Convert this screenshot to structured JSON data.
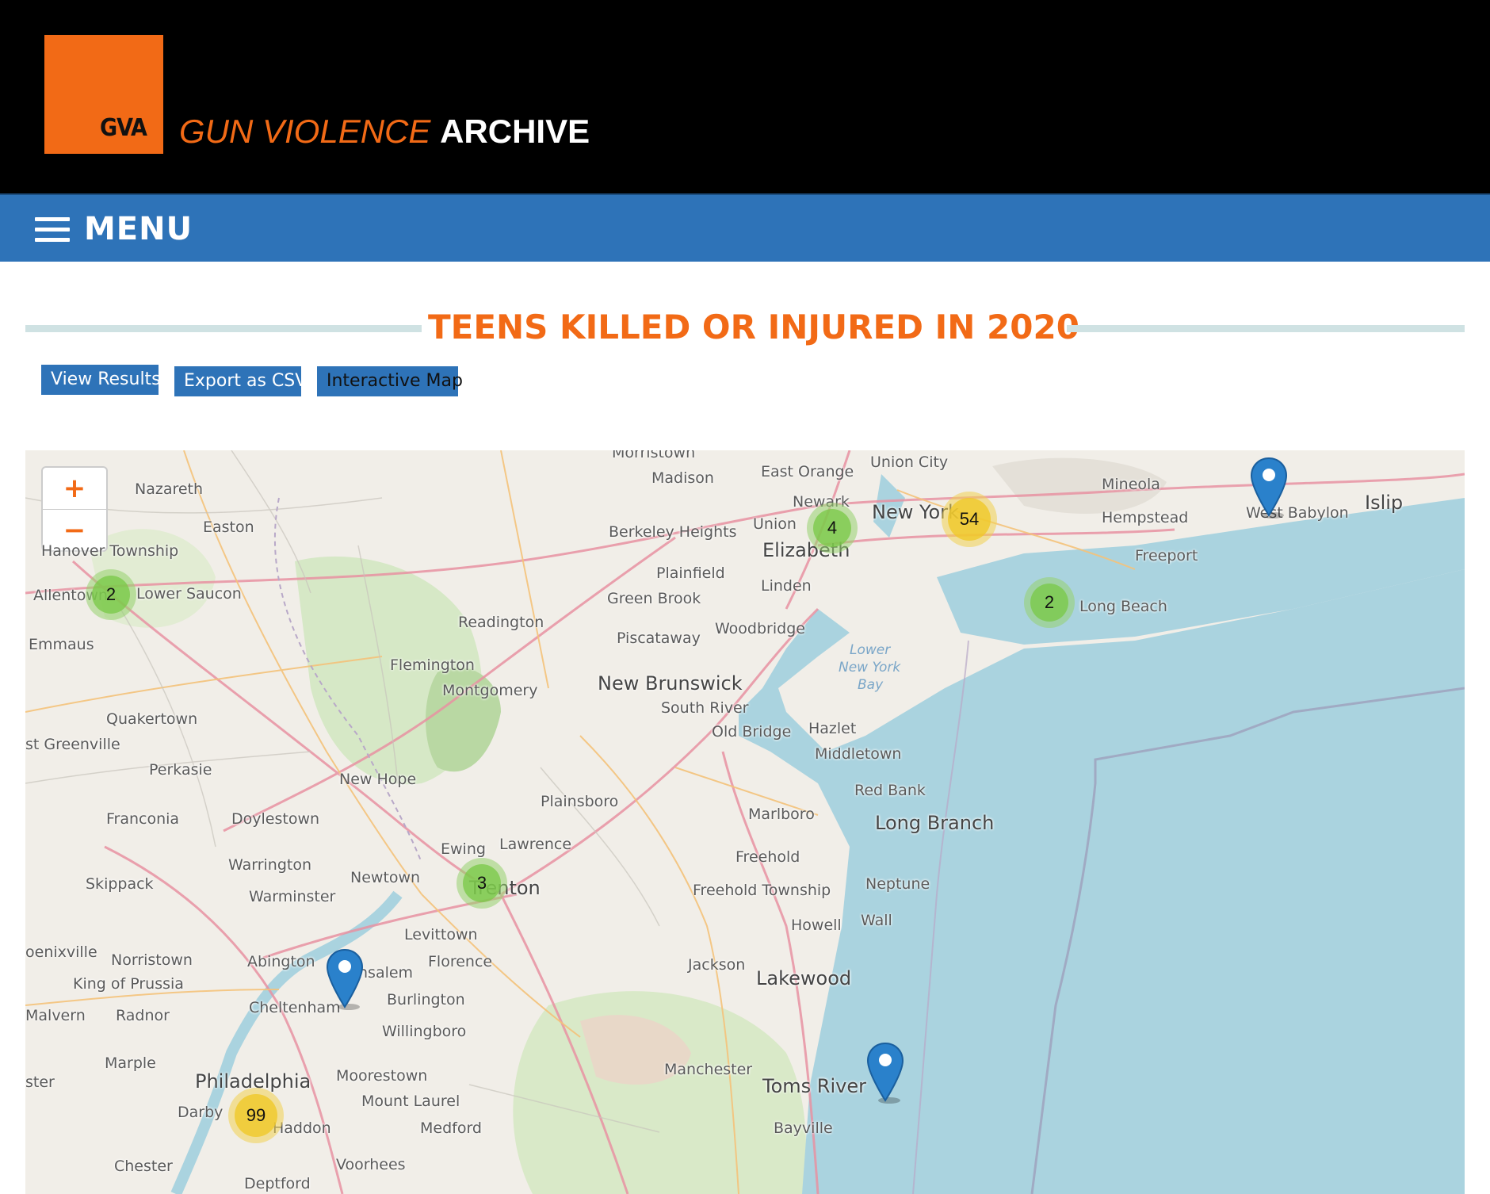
{
  "header": {
    "logo_text": "GVA",
    "site_name_part1": "GUN VIOLENCE",
    "site_name_part2": "ARCHIVE"
  },
  "menu": {
    "label": "MENU"
  },
  "page": {
    "title": "TEENS KILLED OR INJURED IN 2020"
  },
  "buttons": {
    "view_results": "View Results",
    "export_csv": "Export as CSV",
    "interactive_map": "Interactive Map"
  },
  "map": {
    "zoom_in": "+",
    "zoom_out": "−",
    "places": {
      "nazareth": "Nazareth",
      "easton": "Easton",
      "hanover": "Hanover Township",
      "allentown": "Allentown",
      "lower_saucon": "Lower Saucon",
      "emmaus": "Emmaus",
      "quakertown": "Quakertown",
      "greenville": "st Greenville",
      "perkasie": "Perkasie",
      "franconia": "Franconia",
      "doylestown": "Doylestown",
      "skippack": "Skippack",
      "warrington": "Warrington",
      "warminster": "Warminster",
      "newtown": "Newtown",
      "new_hope": "New Hope",
      "phoenixville": "oenixville",
      "norristown": "Norristown",
      "king_prussia": "King of Prussia",
      "abington": "Abington",
      "cheltenham": "Cheltenham",
      "malvern": "Malvern",
      "radnor": "Radnor",
      "marple": "Marple",
      "philadelphia": "Philadelphia",
      "darby": "Darby",
      "haddon": "Haddon",
      "chester": "Chester",
      "deptford": "Deptford",
      "ster": "ster",
      "voorhees": "Voorhees",
      "mount_laurel": "Mount Laurel",
      "moorestown": "Moorestown",
      "medford": "Medford",
      "willingboro": "Willingboro",
      "burlington": "Burlington",
      "salem": "nsalem",
      "florence": "Florence",
      "levittown": "Levittown",
      "ewing": "Ewing",
      "lawrence": "Lawrence",
      "trenton": "Trenton",
      "plainsboro": "Plainsboro",
      "montgomery": "Montgomery",
      "flemington": "Flemington",
      "readington": "Readington",
      "madison": "Madison",
      "morristown": "Morristown",
      "berkeley": "Berkeley Heights",
      "plainfield": "Plainfield",
      "green_brook": "Green Brook",
      "piscataway": "Piscataway",
      "new_brunswick": "New Brunswick",
      "south_river": "South River",
      "old_bridge": "Old Bridge",
      "woodbridge": "Woodbridge",
      "linden": "Linden",
      "elizabeth": "Elizabeth",
      "union": "Union",
      "newark": "Newark",
      "east_orange": "East Orange",
      "union_city": "Union City",
      "new_york": "New York",
      "mineola": "Mineola",
      "hempstead": "Hempstead",
      "freeport": "Freeport",
      "long_beach": "Long Beach",
      "west_babylon": "West Babylon",
      "islip": "Islip",
      "lower_bay1": "Lower",
      "lower_bay2": "New York",
      "lower_bay3": "Bay",
      "hazlet": "Hazlet",
      "middletown": "Middletown",
      "red_bank": "Red Bank",
      "long_branch": "Long Branch",
      "marlboro": "Marlboro",
      "freehold": "Freehold",
      "freehold_twp": "Freehold Township",
      "neptune": "Neptune",
      "howell": "Howell",
      "wall": "Wall",
      "jackson": "Jackson",
      "lakewood": "Lakewood",
      "manchester": "Manchester",
      "toms_river": "Toms River",
      "bayville": "Bayville"
    },
    "clusters": {
      "c_allentown": "2",
      "c_elizabeth": "4",
      "c_newyork": "54",
      "c_longbeach": "2",
      "c_trenton": "3",
      "c_philadelphia": "99"
    }
  }
}
